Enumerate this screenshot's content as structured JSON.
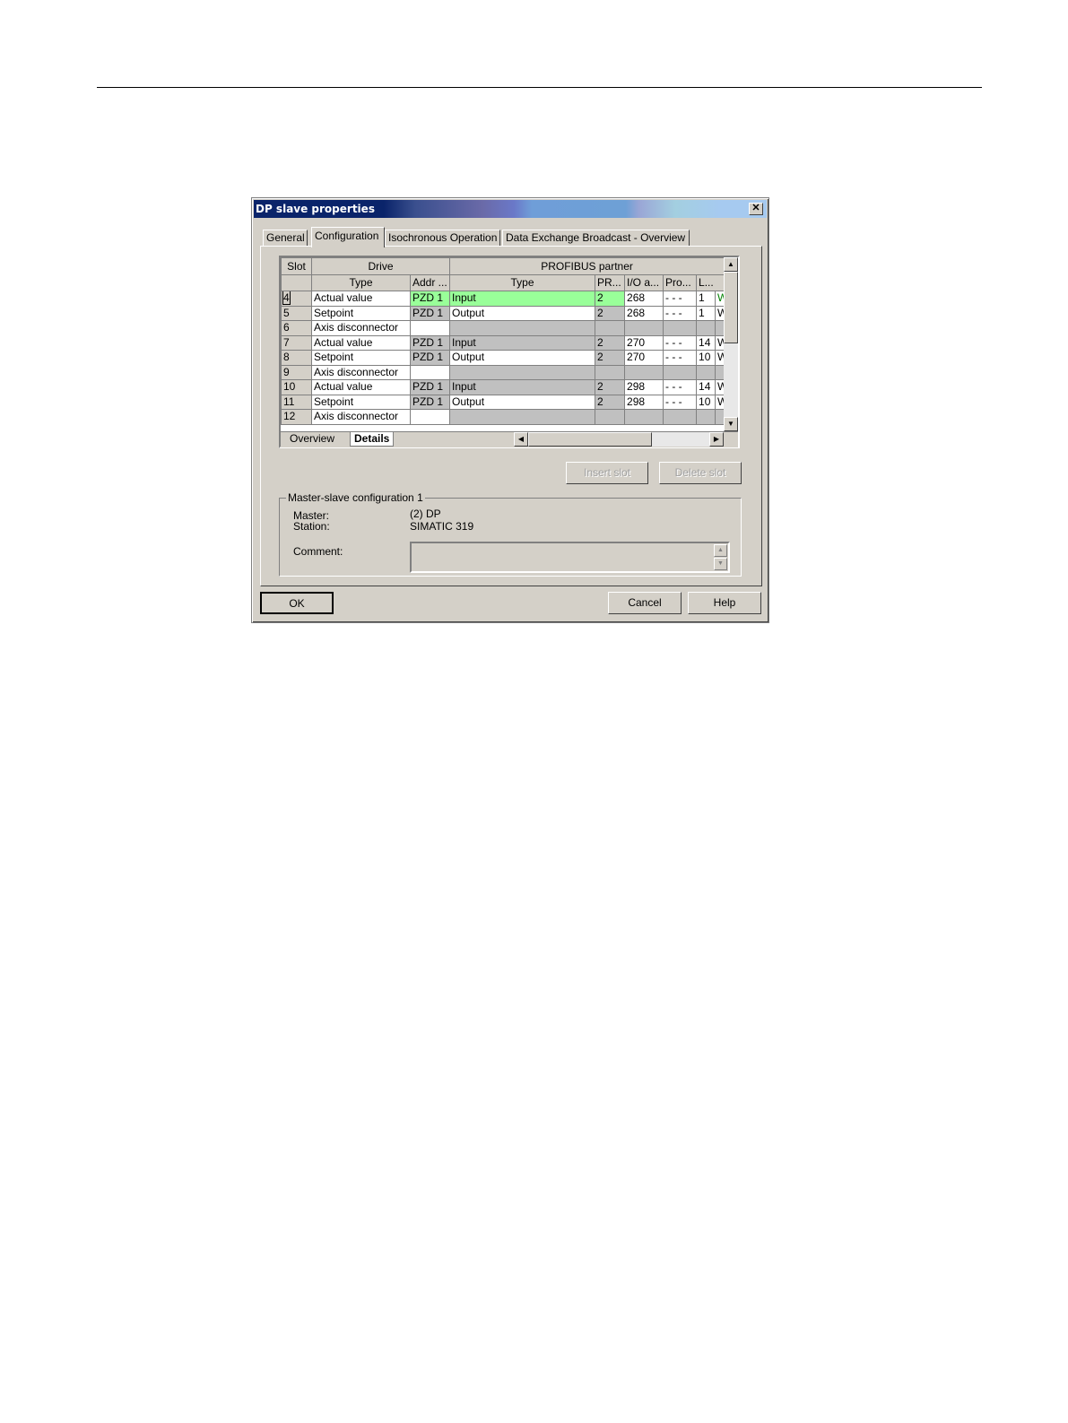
{
  "dialog": {
    "title": "DP slave properties",
    "close_glyph": "✕",
    "tabs": [
      "General",
      "Configuration",
      "Isochronous Operation",
      "Data Exchange Broadcast - Overview"
    ],
    "active_tab": "Configuration"
  },
  "grid": {
    "group_headers": {
      "slot": "Slot",
      "drive": "Drive",
      "partner": "PROFIBUS partner"
    },
    "columns": [
      "Type",
      "Addr ...",
      "Type",
      "PR...",
      "I/O a...",
      "Pro...",
      "L..."
    ],
    "rows": [
      {
        "slot": "4",
        "type": "Actual value",
        "addr": "PZD 1",
        "ptype": "Input",
        "pr": "2",
        "io": "268",
        "pro": "- - -",
        "l": "1",
        "x": "W",
        "highlight": true
      },
      {
        "slot": "5",
        "type": "Setpoint",
        "addr": "PZD 1",
        "ptype": "Output",
        "pr": "2",
        "io": "268",
        "pro": "- - -",
        "l": "1",
        "x": "W"
      },
      {
        "slot": "6",
        "type": "Axis disconnector",
        "addr": "",
        "ptype": "",
        "pr": "",
        "io": "",
        "pro": "",
        "l": "",
        "x": ""
      },
      {
        "slot": "7",
        "type": "Actual value",
        "addr": "PZD 1",
        "ptype": "Input",
        "pr": "2",
        "io": "270",
        "pro": "- - -",
        "l": "14",
        "x": "W"
      },
      {
        "slot": "8",
        "type": "Setpoint",
        "addr": "PZD 1",
        "ptype": "Output",
        "pr": "2",
        "io": "270",
        "pro": "- - -",
        "l": "10",
        "x": "W"
      },
      {
        "slot": "9",
        "type": "Axis disconnector",
        "addr": "",
        "ptype": "",
        "pr": "",
        "io": "",
        "pro": "",
        "l": "",
        "x": ""
      },
      {
        "slot": "10",
        "type": "Actual value",
        "addr": "PZD 1",
        "ptype": "Input",
        "pr": "2",
        "io": "298",
        "pro": "- - -",
        "l": "14",
        "x": "W"
      },
      {
        "slot": "11",
        "type": "Setpoint",
        "addr": "PZD 1",
        "ptype": "Output",
        "pr": "2",
        "io": "298",
        "pro": "- - -",
        "l": "10",
        "x": "W"
      },
      {
        "slot": "12",
        "type": "Axis disconnector",
        "addr": "",
        "ptype": "",
        "pr": "",
        "io": "",
        "pro": "",
        "l": "",
        "x": ""
      }
    ],
    "sheet_tabs": [
      "Overview",
      "Details"
    ],
    "active_sheet": "Details",
    "scroll_glyphs": {
      "up": "▲",
      "down": "▼",
      "left": "◀",
      "right": "▶"
    }
  },
  "buttons": {
    "insert_slot": "Insert slot",
    "delete_slot": "Delete slot",
    "ok": "OK",
    "cancel": "Cancel",
    "help": "Help"
  },
  "master_slave": {
    "legend": "Master-slave configuration 1",
    "master_label": "Master:",
    "master_value": "(2) DP",
    "station_label": "Station:",
    "station_value": "SIMATIC 319",
    "comment_label": "Comment:",
    "comment_value": "",
    "spin_up": "▲",
    "spin_down": "▼"
  },
  "colors": {
    "selected_row": "#99ff99",
    "dialog_face": "#d4d0c8",
    "title_dark": "#0a246a"
  }
}
